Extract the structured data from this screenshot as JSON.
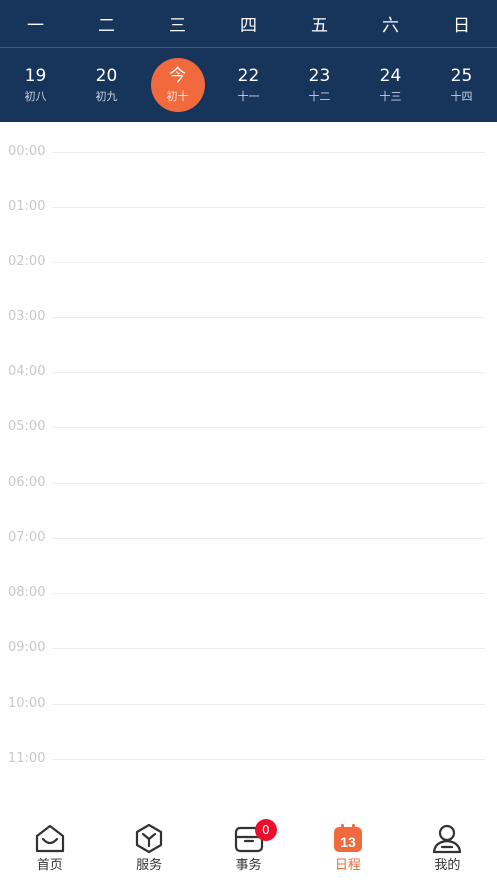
{
  "header": {
    "weekdays": [
      "一",
      "二",
      "三",
      "四",
      "五",
      "六",
      "日"
    ],
    "dates": [
      {
        "num": "19",
        "lunar": "初八"
      },
      {
        "num": "20",
        "lunar": "初九"
      },
      {
        "num": "今",
        "lunar": "初十"
      },
      {
        "num": "22",
        "lunar": "十一"
      },
      {
        "num": "23",
        "lunar": "十二"
      },
      {
        "num": "24",
        "lunar": "十三"
      },
      {
        "num": "25",
        "lunar": "十四"
      }
    ]
  },
  "timeline": {
    "hours": [
      "00:00",
      "01:00",
      "02:00",
      "03:00",
      "04:00",
      "05:00",
      "06:00",
      "07:00",
      "08:00",
      "09:00",
      "10:00",
      "11:00"
    ]
  },
  "nav": {
    "items": [
      {
        "label": "首页",
        "icon": "home-icon"
      },
      {
        "label": "服务",
        "icon": "cube-icon"
      },
      {
        "label": "事务",
        "icon": "folder-icon"
      },
      {
        "label": "日程",
        "icon": "calendar-icon"
      },
      {
        "label": "我的",
        "icon": "user-icon"
      }
    ],
    "badge": "0",
    "calendar_icon_text": "13"
  },
  "colors": {
    "header_bg": "#17345a",
    "accent": "#f06a3e",
    "badge": "#e8102e"
  }
}
